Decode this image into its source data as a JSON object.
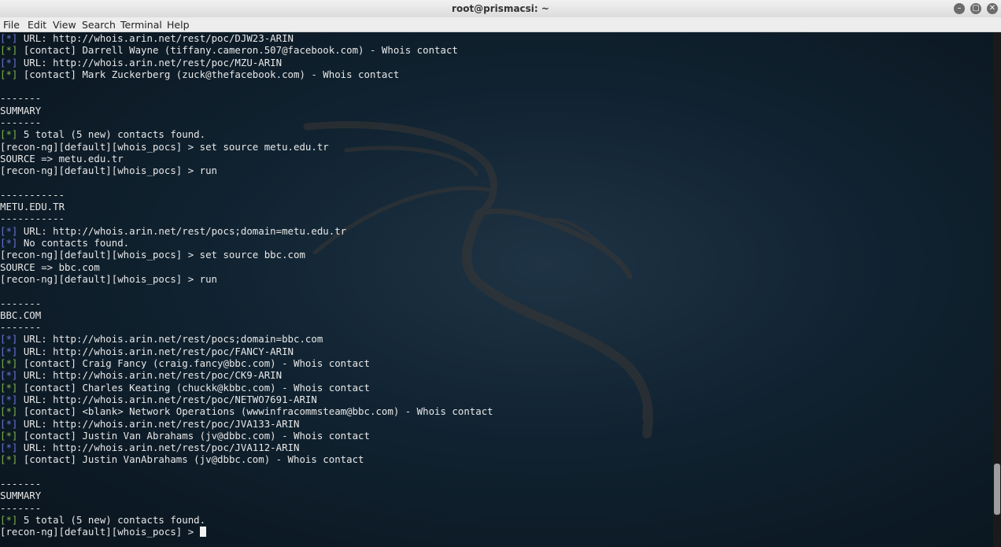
{
  "window": {
    "title": "root@prismacsi: ~",
    "controls": {
      "minimize": "–",
      "maximize": "▢",
      "close": "✕"
    }
  },
  "menu": [
    "File",
    "Edit",
    "View",
    "Search",
    "Terminal",
    "Help"
  ],
  "terminal": {
    "lines": [
      {
        "m": "[*]",
        "t": " URL: http://whois.arin.net/rest/poc/DJW23-ARIN"
      },
      {
        "p": "[*]",
        "t": " [contact] Darrell Wayne (tiffany.cameron.507@facebook.com) - Whois contact"
      },
      {
        "m": "[*]",
        "t": " URL: http://whois.arin.net/rest/poc/MZU-ARIN"
      },
      {
        "p": "[*]",
        "t": " [contact] Mark Zuckerberg (zuck@thefacebook.com) - Whois contact"
      },
      {
        "t": ""
      },
      {
        "t": "-------"
      },
      {
        "t": "SUMMARY"
      },
      {
        "t": "-------"
      },
      {
        "p": "[*]",
        "t": " 5 total (5 new) contacts found."
      },
      {
        "t": "[recon-ng][default][whois_pocs] > set source metu.edu.tr"
      },
      {
        "t": "SOURCE => metu.edu.tr"
      },
      {
        "t": "[recon-ng][default][whois_pocs] > run"
      },
      {
        "t": ""
      },
      {
        "t": "-----------"
      },
      {
        "t": "METU.EDU.TR"
      },
      {
        "t": "-----------"
      },
      {
        "m": "[*]",
        "t": " URL: http://whois.arin.net/rest/pocs;domain=metu.edu.tr"
      },
      {
        "m": "[*]",
        "t": " No contacts found."
      },
      {
        "t": "[recon-ng][default][whois_pocs] > set source bbc.com"
      },
      {
        "t": "SOURCE => bbc.com"
      },
      {
        "t": "[recon-ng][default][whois_pocs] > run"
      },
      {
        "t": ""
      },
      {
        "t": "-------"
      },
      {
        "t": "BBC.COM"
      },
      {
        "t": "-------"
      },
      {
        "m": "[*]",
        "t": " URL: http://whois.arin.net/rest/pocs;domain=bbc.com"
      },
      {
        "m": "[*]",
        "t": " URL: http://whois.arin.net/rest/poc/FANCY-ARIN"
      },
      {
        "p": "[*]",
        "t": " [contact] Craig Fancy (craig.fancy@bbc.com) - Whois contact"
      },
      {
        "m": "[*]",
        "t": " URL: http://whois.arin.net/rest/poc/CK9-ARIN"
      },
      {
        "p": "[*]",
        "t": " [contact] Charles Keating (chuckk@kbbc.com) - Whois contact"
      },
      {
        "m": "[*]",
        "t": " URL: http://whois.arin.net/rest/poc/NETWO7691-ARIN"
      },
      {
        "p": "[*]",
        "t": " [contact] <blank> Network Operations (wwwinfracommsteam@bbc.com) - Whois contact"
      },
      {
        "m": "[*]",
        "t": " URL: http://whois.arin.net/rest/poc/JVA133-ARIN"
      },
      {
        "p": "[*]",
        "t": " [contact] Justin Van Abrahams (jv@dbbc.com) - Whois contact"
      },
      {
        "m": "[*]",
        "t": " URL: http://whois.arin.net/rest/poc/JVA112-ARIN"
      },
      {
        "p": "[*]",
        "t": " [contact] Justin VanAbrahams (jv@dbbc.com) - Whois contact"
      },
      {
        "t": ""
      },
      {
        "t": "-------"
      },
      {
        "t": "SUMMARY"
      },
      {
        "t": "-------"
      },
      {
        "p": "[*]",
        "t": " 5 total (5 new) contacts found."
      },
      {
        "t": "[recon-ng][default][whois_pocs] > ",
        "cursor": true
      }
    ]
  },
  "scrollbar": {
    "position": 0.93,
    "visible_fraction": 0.1
  },
  "colors": {
    "prefix_info": "#6b75d6",
    "prefix_success": "#7fb34a",
    "text": "#e8e8e8",
    "background": "#0b1620"
  }
}
